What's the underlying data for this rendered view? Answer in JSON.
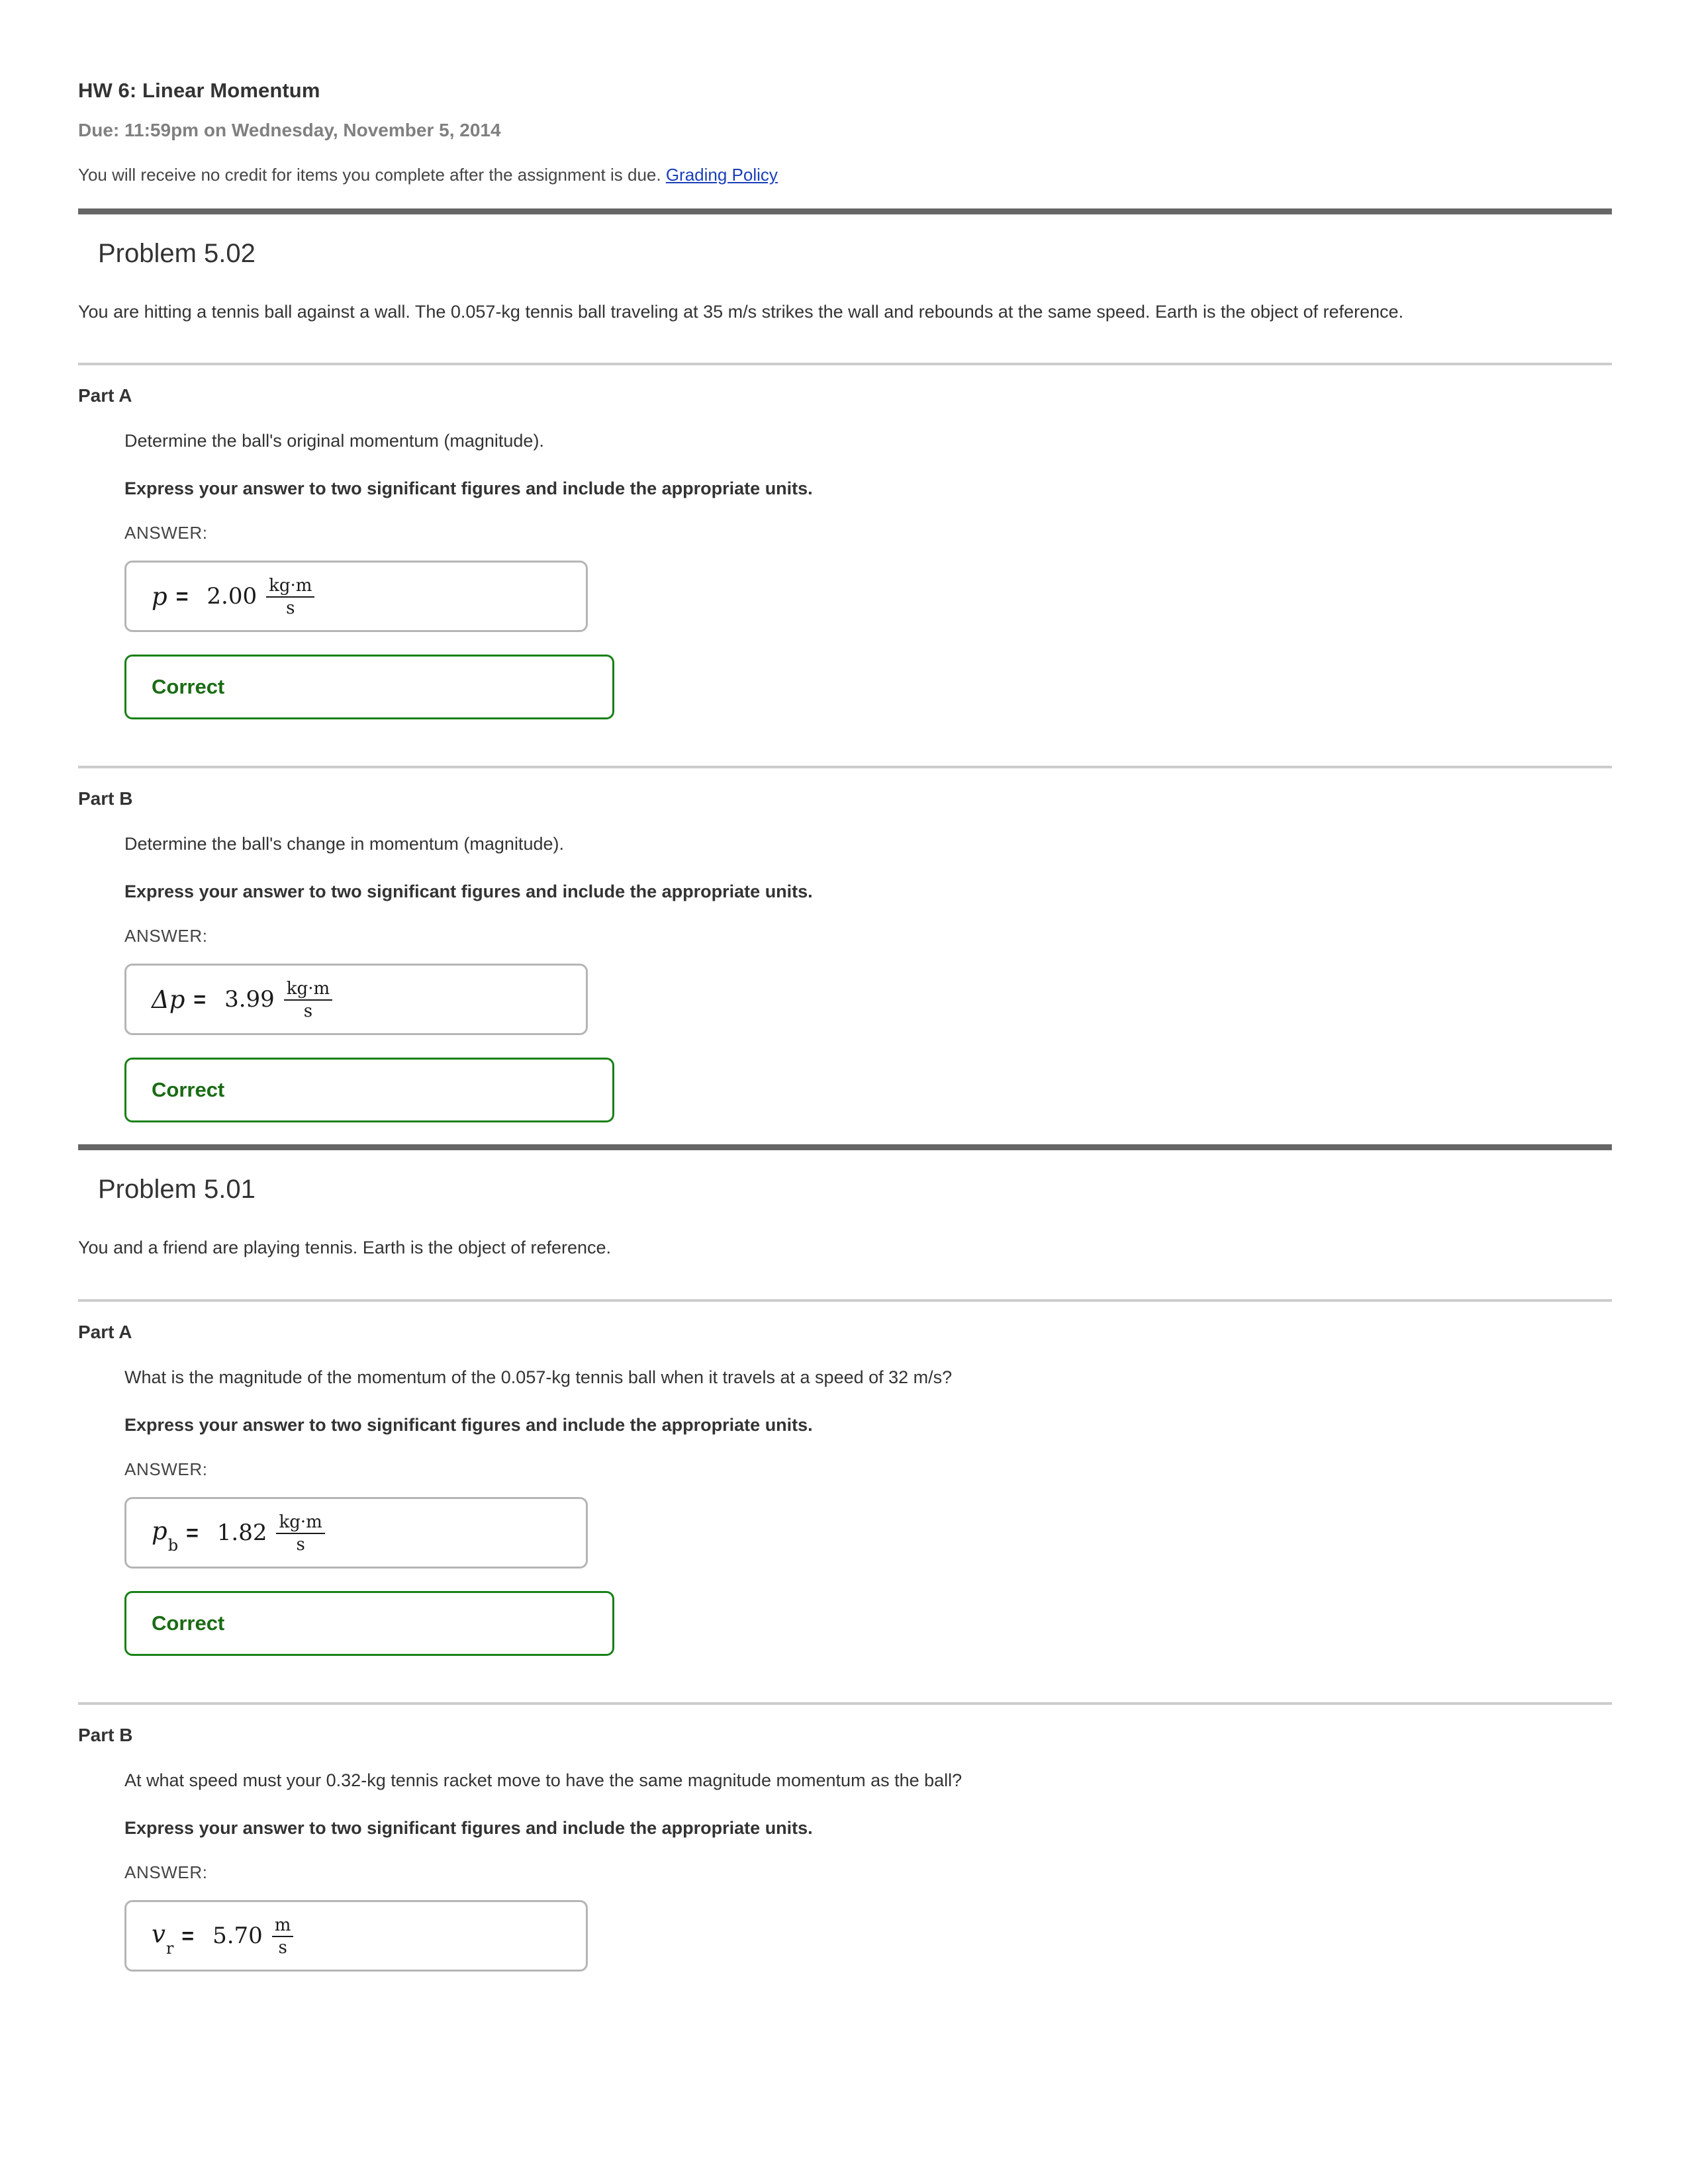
{
  "header": {
    "title": "HW 6: Linear Momentum",
    "due": "Due: 11:59pm on Wednesday, November 5, 2014",
    "note_text": "You will receive no credit for items you complete after the assignment is due.",
    "grading_link": "Grading Policy"
  },
  "colors": {
    "thick_rule": "#666666",
    "thin_rule": "#cccccc",
    "link": "#1a3fba",
    "correct_border": "#1a8017",
    "correct_text": "#1a6b14",
    "field_border": "#b5b5b5"
  },
  "problems": [
    {
      "title": "Problem 5.02",
      "statement": "You are hitting a tennis ball against a wall. The 0.057-kg tennis ball traveling at 35 m/s strikes the wall and rebounds at the same speed. Earth is the object of reference.",
      "parts": [
        {
          "label": "Part A",
          "question": "Determine the ball's original momentum (magnitude).",
          "instruction": "Express your answer to two significant figures and include the appropriate units.",
          "answer_label": "ANSWER:",
          "answer": {
            "symbol": "p",
            "subscript": "",
            "equals": "=",
            "value": "2.00",
            "unit_numerator": "kg·m",
            "unit_denominator": "s"
          },
          "status": "Correct"
        },
        {
          "label": "Part B",
          "question": "Determine the ball's change in momentum (magnitude).",
          "instruction": "Express your answer to two significant figures and include the appropriate units.",
          "answer_label": "ANSWER:",
          "answer": {
            "symbol": "Δp",
            "subscript": "",
            "equals": "=",
            "value": "3.99",
            "unit_numerator": "kg·m",
            "unit_denominator": "s"
          },
          "status": "Correct"
        }
      ]
    },
    {
      "title": "Problem 5.01",
      "statement": "You and a friend are playing tennis. Earth is the object of reference.",
      "parts": [
        {
          "label": "Part A",
          "question": "What is the magnitude of the momentum of the 0.057-kg tennis ball when it travels at a speed of 32 m/s?",
          "instruction": "Express your answer to two significant figures and include the appropriate units.",
          "answer_label": "ANSWER:",
          "answer": {
            "symbol": "p",
            "subscript": "b",
            "equals": "=",
            "value": "1.82",
            "unit_numerator": "kg·m",
            "unit_denominator": "s"
          },
          "status": "Correct"
        },
        {
          "label": "Part B",
          "question": "At what speed must your 0.32-kg tennis racket move to have the same magnitude momentum as the ball?",
          "instruction": "Express your answer to two significant figures and include the appropriate units.",
          "answer_label": "ANSWER:",
          "answer": {
            "symbol": "v",
            "subscript": "r",
            "equals": "=",
            "value": "5.70",
            "unit_numerator": "m",
            "unit_denominator": "s"
          },
          "status": ""
        }
      ]
    }
  ]
}
